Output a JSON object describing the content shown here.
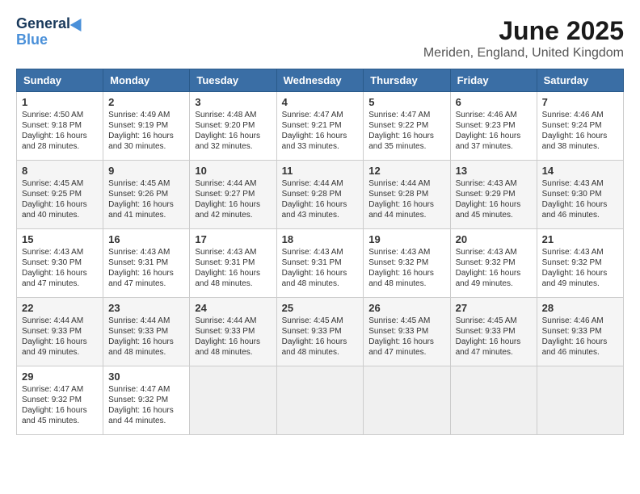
{
  "title": "June 2025",
  "subtitle": "Meriden, England, United Kingdom",
  "logo": {
    "line1": "General",
    "line2": "Blue"
  },
  "headers": [
    "Sunday",
    "Monday",
    "Tuesday",
    "Wednesday",
    "Thursday",
    "Friday",
    "Saturday"
  ],
  "weeks": [
    [
      {
        "day": "1",
        "info": "Sunrise: 4:50 AM\nSunset: 9:18 PM\nDaylight: 16 hours\nand 28 minutes."
      },
      {
        "day": "2",
        "info": "Sunrise: 4:49 AM\nSunset: 9:19 PM\nDaylight: 16 hours\nand 30 minutes."
      },
      {
        "day": "3",
        "info": "Sunrise: 4:48 AM\nSunset: 9:20 PM\nDaylight: 16 hours\nand 32 minutes."
      },
      {
        "day": "4",
        "info": "Sunrise: 4:47 AM\nSunset: 9:21 PM\nDaylight: 16 hours\nand 33 minutes."
      },
      {
        "day": "5",
        "info": "Sunrise: 4:47 AM\nSunset: 9:22 PM\nDaylight: 16 hours\nand 35 minutes."
      },
      {
        "day": "6",
        "info": "Sunrise: 4:46 AM\nSunset: 9:23 PM\nDaylight: 16 hours\nand 37 minutes."
      },
      {
        "day": "7",
        "info": "Sunrise: 4:46 AM\nSunset: 9:24 PM\nDaylight: 16 hours\nand 38 minutes."
      }
    ],
    [
      {
        "day": "8",
        "info": "Sunrise: 4:45 AM\nSunset: 9:25 PM\nDaylight: 16 hours\nand 40 minutes."
      },
      {
        "day": "9",
        "info": "Sunrise: 4:45 AM\nSunset: 9:26 PM\nDaylight: 16 hours\nand 41 minutes."
      },
      {
        "day": "10",
        "info": "Sunrise: 4:44 AM\nSunset: 9:27 PM\nDaylight: 16 hours\nand 42 minutes."
      },
      {
        "day": "11",
        "info": "Sunrise: 4:44 AM\nSunset: 9:28 PM\nDaylight: 16 hours\nand 43 minutes."
      },
      {
        "day": "12",
        "info": "Sunrise: 4:44 AM\nSunset: 9:28 PM\nDaylight: 16 hours\nand 44 minutes."
      },
      {
        "day": "13",
        "info": "Sunrise: 4:43 AM\nSunset: 9:29 PM\nDaylight: 16 hours\nand 45 minutes."
      },
      {
        "day": "14",
        "info": "Sunrise: 4:43 AM\nSunset: 9:30 PM\nDaylight: 16 hours\nand 46 minutes."
      }
    ],
    [
      {
        "day": "15",
        "info": "Sunrise: 4:43 AM\nSunset: 9:30 PM\nDaylight: 16 hours\nand 47 minutes."
      },
      {
        "day": "16",
        "info": "Sunrise: 4:43 AM\nSunset: 9:31 PM\nDaylight: 16 hours\nand 47 minutes."
      },
      {
        "day": "17",
        "info": "Sunrise: 4:43 AM\nSunset: 9:31 PM\nDaylight: 16 hours\nand 48 minutes."
      },
      {
        "day": "18",
        "info": "Sunrise: 4:43 AM\nSunset: 9:31 PM\nDaylight: 16 hours\nand 48 minutes."
      },
      {
        "day": "19",
        "info": "Sunrise: 4:43 AM\nSunset: 9:32 PM\nDaylight: 16 hours\nand 48 minutes."
      },
      {
        "day": "20",
        "info": "Sunrise: 4:43 AM\nSunset: 9:32 PM\nDaylight: 16 hours\nand 49 minutes."
      },
      {
        "day": "21",
        "info": "Sunrise: 4:43 AM\nSunset: 9:32 PM\nDaylight: 16 hours\nand 49 minutes."
      }
    ],
    [
      {
        "day": "22",
        "info": "Sunrise: 4:44 AM\nSunset: 9:33 PM\nDaylight: 16 hours\nand 49 minutes."
      },
      {
        "day": "23",
        "info": "Sunrise: 4:44 AM\nSunset: 9:33 PM\nDaylight: 16 hours\nand 48 minutes."
      },
      {
        "day": "24",
        "info": "Sunrise: 4:44 AM\nSunset: 9:33 PM\nDaylight: 16 hours\nand 48 minutes."
      },
      {
        "day": "25",
        "info": "Sunrise: 4:45 AM\nSunset: 9:33 PM\nDaylight: 16 hours\nand 48 minutes."
      },
      {
        "day": "26",
        "info": "Sunrise: 4:45 AM\nSunset: 9:33 PM\nDaylight: 16 hours\nand 47 minutes."
      },
      {
        "day": "27",
        "info": "Sunrise: 4:45 AM\nSunset: 9:33 PM\nDaylight: 16 hours\nand 47 minutes."
      },
      {
        "day": "28",
        "info": "Sunrise: 4:46 AM\nSunset: 9:33 PM\nDaylight: 16 hours\nand 46 minutes."
      }
    ],
    [
      {
        "day": "29",
        "info": "Sunrise: 4:47 AM\nSunset: 9:32 PM\nDaylight: 16 hours\nand 45 minutes."
      },
      {
        "day": "30",
        "info": "Sunrise: 4:47 AM\nSunset: 9:32 PM\nDaylight: 16 hours\nand 44 minutes."
      },
      null,
      null,
      null,
      null,
      null
    ]
  ]
}
